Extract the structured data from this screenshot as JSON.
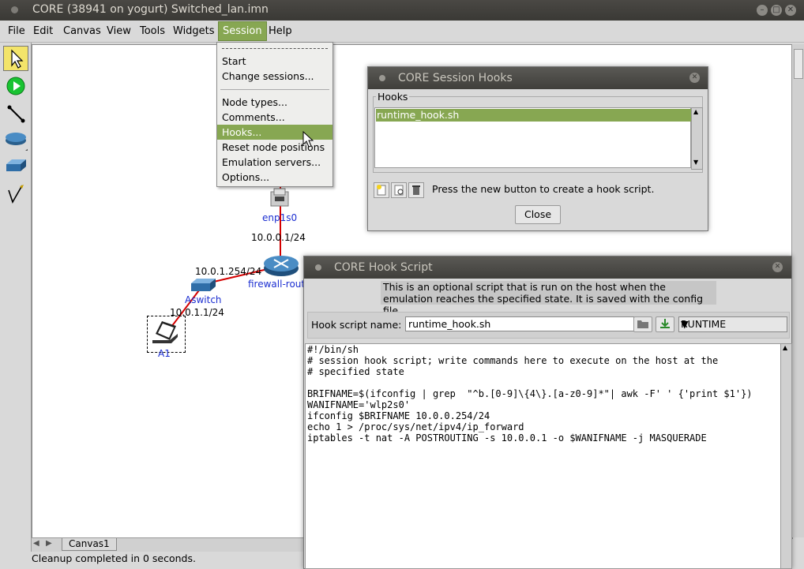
{
  "window": {
    "title": "CORE (38941 on yogurt) Switched_lan.imn",
    "buttons": [
      "–",
      "□",
      "✕"
    ]
  },
  "menubar": [
    "File",
    "Edit",
    "Canvas",
    "View",
    "Tools",
    "Widgets",
    "Session",
    "Help"
  ],
  "toolbar": {
    "tools": [
      "select-tool",
      "start-tool",
      "link-tool",
      "router-tool",
      "switch-tool",
      "annotation-tool"
    ]
  },
  "session_menu": {
    "items": [
      "Start",
      "Change sessions...",
      "Node types...",
      "Comments...",
      "Hooks...",
      "Reset node positions",
      "Emulation servers...",
      "Options..."
    ]
  },
  "topology": {
    "labels": {
      "enp1s0": "enp1s0",
      "enp_addr": "10.0.0.1/24",
      "router_addr": "10.0.1.254/24",
      "router_name": "firewall-rout",
      "switch_name": "Aswitch",
      "host_addr": "10.0.1.1/24",
      "host_name": "A1"
    },
    "link_color": "#d40000"
  },
  "canvas_tab": "Canvas1",
  "status": "Cleanup completed in 0 seconds.",
  "hooks_dialog": {
    "title": "CORE Session Hooks",
    "frame_label": "Hooks",
    "hooks": [
      "runtime_hook.sh"
    ],
    "help": "Press the new button to create a hook script.",
    "close": "Close"
  },
  "script_dialog": {
    "title": "CORE Hook Script",
    "info_line1": "This is an optional script that is run on the host when the",
    "info_line2": " emulation reaches the specified state. It is saved with the config file.",
    "name_label": "Hook script name:",
    "name_value": "runtime_hook.sh",
    "state": "RUNTIME",
    "lines": [
      "#!/bin/sh",
      "# session hook script; write commands here to execute on the host at the",
      "# specified state",
      "",
      "BRIFNAME=$(ifconfig | grep  \"^b.[0-9]\\{4\\}.[a-z0-9]*\"| awk -F' ' {'print $1'})",
      "WANIFNAME='wlp2s0'",
      "ifconfig $BRIFNAME 10.0.0.254/24",
      "echo 1 > /proc/sys/net/ipv4/ip_forward",
      "iptables -t nat -A POSTROUTING -s 10.0.0.1 -o $WANIFNAME -j MASQUERADE"
    ]
  },
  "accent_color": "#87a752"
}
